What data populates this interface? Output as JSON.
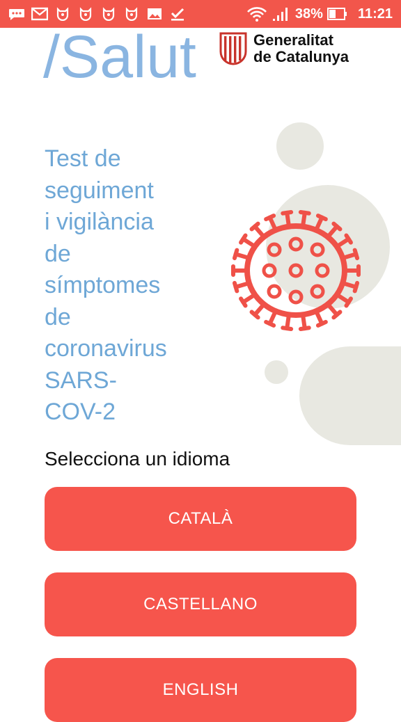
{
  "status_bar": {
    "battery": "38%",
    "time": "11:21",
    "icons": [
      "chat-icon",
      "gmail-icon",
      "app-icon",
      "app-icon",
      "app-icon",
      "app-icon",
      "image-icon",
      "download-done-icon",
      "wifi-icon",
      "signal-icon",
      "battery-icon"
    ]
  },
  "header": {
    "logo_text": "/Salut",
    "gencat_line1": "Generalitat",
    "gencat_line2": "de Catalunya"
  },
  "main": {
    "title_lines": [
      "Test de",
      "seguiment",
      "i vigilància",
      "de",
      "símptomes",
      "de",
      "coronavirus",
      "SARS-",
      "COV-2"
    ],
    "select_language_label": "Selecciona un idioma",
    "languages": [
      "CATALÀ",
      "CASTELLANO",
      "ENGLISH"
    ]
  },
  "colors": {
    "accent": "#f6554c",
    "status_bar": "#f2564b",
    "title_blue": "#6ea7d6",
    "logo_blue": "#8ab5e1",
    "circle_grey": "#e8e8e1"
  }
}
